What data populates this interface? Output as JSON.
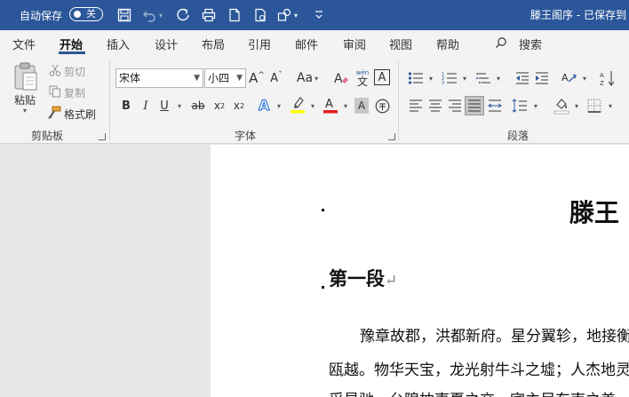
{
  "titlebar": {
    "autosave_label": "自动保存",
    "autosave_state": "关",
    "doc_title": "滕王阁序 - 已保存到"
  },
  "tabs": [
    "文件",
    "开始",
    "插入",
    "设计",
    "布局",
    "引用",
    "邮件",
    "审阅",
    "视图",
    "帮助"
  ],
  "search_label": "搜索",
  "clipboard": {
    "paste": "粘贴",
    "cut": "剪切",
    "copy": "复制",
    "format_painter": "格式刷",
    "group_label": "剪贴板"
  },
  "font": {
    "font_name": "宋体",
    "font_size": "小四",
    "group_label": "字体",
    "phonetic_top": "wén",
    "phonetic_bottom": "文"
  },
  "paragraph": {
    "group_label": "段落"
  },
  "colors": {
    "accent": "#2b579a",
    "highlight": "#ffff00",
    "font_color": "#e02020",
    "text_effect": "#2f7ed8"
  },
  "document": {
    "title": "滕王",
    "heading": "第一段",
    "return_mark": "↵",
    "lines": [
      "豫章故郡，洪都新府。星分翼轸，地接衡",
      "瓯越。物华天宝，龙光射牛斗之墟；人杰地灵",
      "采星驰。台隍枕夷夏之交，宾主尽东南之美"
    ]
  }
}
